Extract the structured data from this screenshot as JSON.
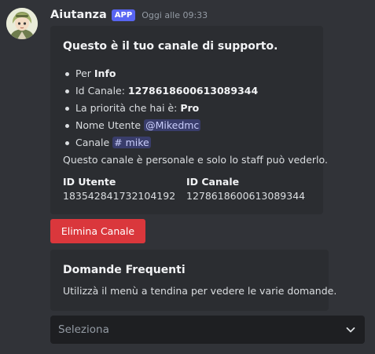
{
  "author": {
    "username": "Aiutanza",
    "badge": "APP",
    "timestamp": "Oggi alle 09:33"
  },
  "support_embed": {
    "title": "Questo è il tuo canale di supporto.",
    "items": [
      {
        "prefix": "Per ",
        "value": "Info"
      },
      {
        "prefix": "Id Canale: ",
        "value": "1278618600613089344"
      },
      {
        "prefix": "La priorità che hai è: ",
        "value": "Pro"
      },
      {
        "prefix": "Nome Utente ",
        "mention": "@Mikedmc"
      },
      {
        "prefix": "Canale ",
        "channel_hash": "#",
        "channel": "mike"
      }
    ],
    "description": "Questo canale è personale e solo lo staff può vederlo.",
    "fields": [
      {
        "name": "ID Utente",
        "value": "183542841732104192"
      },
      {
        "name": "ID Canale",
        "value": "1278618600613089344"
      }
    ]
  },
  "delete_button": {
    "label": "Elimina Canale"
  },
  "faq_embed": {
    "title": "Domande Frequenti",
    "description": "Utilizzà il menù a tendina per vedere le varie domande."
  },
  "select_menu": {
    "placeholder": "Seleziona"
  },
  "icons": {
    "select_arrow": "chevron-down-icon"
  },
  "colors": {
    "background": "#313338",
    "embed_background": "#2b2d31",
    "app_badge": "#5865f2",
    "danger_button": "#da373c",
    "select_background": "#1e1f22"
  }
}
